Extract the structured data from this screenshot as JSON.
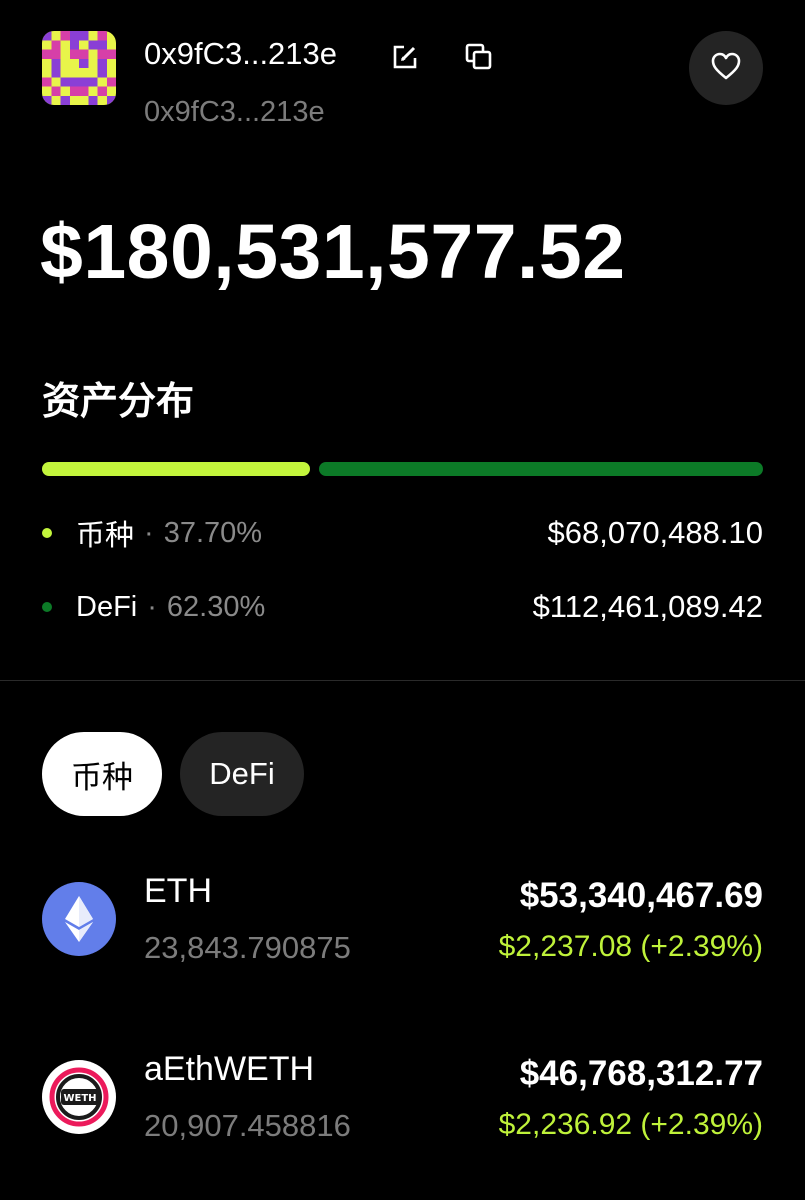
{
  "header": {
    "address": "0x9fC3...213e",
    "address_sub": "0x9fC3...213e",
    "icons": {
      "avatar": "pixel-avatar",
      "edit": "edit-icon",
      "copy": "copy-icon",
      "favorite": "heart-icon"
    }
  },
  "total_balance": "$180,531,577.52",
  "distribution": {
    "title": "资产分布",
    "bar_fractions": [
      0.377,
      0.623
    ],
    "items": [
      {
        "name": "币种",
        "separator": "·",
        "percent": "37.70%",
        "value": "$68,070,488.10",
        "color": "#c3f53c"
      },
      {
        "name": "DeFi",
        "separator": "·",
        "percent": "62.30%",
        "value": "$112,461,089.42",
        "color": "#0c7a27"
      }
    ]
  },
  "tabs": [
    {
      "label": "币种",
      "active": true
    },
    {
      "label": "DeFi",
      "active": false
    }
  ],
  "tokens": [
    {
      "name": "ETH",
      "amount": "23,843.790875",
      "value": "$53,340,467.69",
      "price": "$2,237.08 (+2.39%)",
      "icon": "ethereum-icon"
    },
    {
      "name": "aEthWETH",
      "amount": "20,907.458816",
      "value": "$46,768,312.77",
      "price": "$2,236.92 (+2.39%)",
      "icon": "weth-icon"
    }
  ],
  "colors": {
    "accent_lime": "#c3f53c",
    "accent_green": "#0c7a27",
    "price_up": "#bff23a",
    "eth_blue": "#627eea"
  }
}
